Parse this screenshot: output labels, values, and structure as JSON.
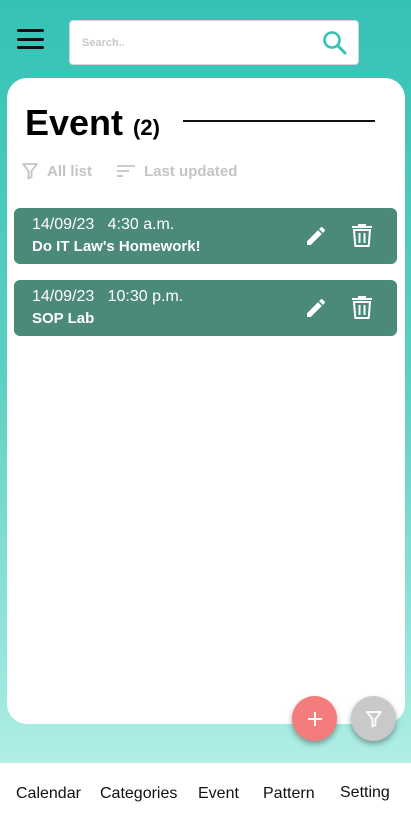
{
  "search": {
    "placeholder": "Search.."
  },
  "header": {
    "title": "Event",
    "count": "(2)"
  },
  "filters": {
    "all_list": "All list",
    "sort": "Last updated"
  },
  "events": [
    {
      "date": "14/09/23",
      "time": "4:30 a.m.",
      "name": "Do IT Law's Homework!"
    },
    {
      "date": "14/09/23",
      "time": "10:30 p.m.",
      "name": "SOP Lab"
    }
  ],
  "nav": {
    "items": [
      {
        "label": "Calendar"
      },
      {
        "label": "Categories"
      },
      {
        "label": "Event"
      },
      {
        "label": "Pattern"
      },
      {
        "label": "Setting"
      }
    ]
  },
  "colors": {
    "accent": "#35c2b6",
    "event_card": "#4b8a78",
    "add_button": "#f47c7c",
    "filter_button": "#c9c9c9"
  },
  "icons": {
    "menu": "hamburger-menu-icon",
    "search": "search-icon",
    "filter": "filter-icon",
    "sort": "sort-icon",
    "edit": "pencil-icon",
    "delete": "trash-icon",
    "add": "plus-icon"
  }
}
